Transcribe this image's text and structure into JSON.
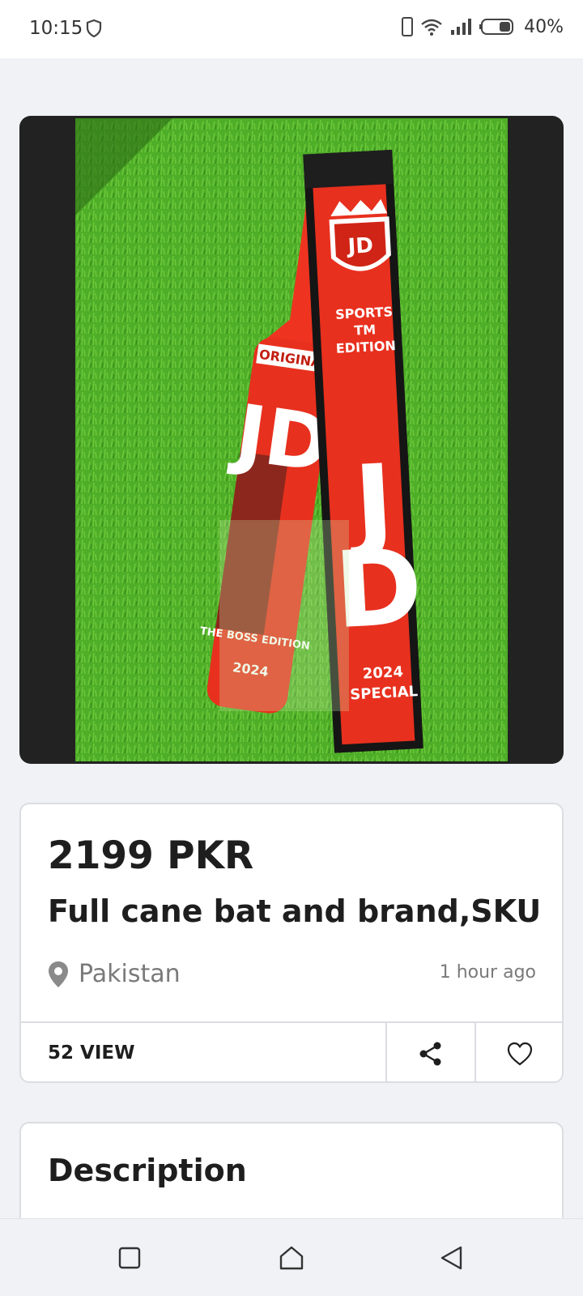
{
  "status_bar": {
    "time": "10:15",
    "battery": "40%"
  },
  "listing": {
    "image_alt": "Cricket bat and cover product photo",
    "image_texts": {
      "bat_top": "ORIGINAL",
      "bat_logo": "JD",
      "bat_edition": "THE BOSS EDITION",
      "bat_year": "2024",
      "cover_brand": "JD",
      "cover_line1": "SPORTS",
      "cover_line2": "TM",
      "cover_line3": "EDITION",
      "cover_year": "2024",
      "cover_special": "SPECIAL"
    },
    "price": "2199 PKR",
    "title": "Full cane bat and brand,SKU",
    "location": "Pakistan",
    "posted": "1 hour ago",
    "views": "52 VIEW"
  },
  "description": {
    "heading": "Description"
  },
  "colors": {
    "accent": "#e8301e",
    "grass": "#4fae28",
    "text": "#1e1e1e",
    "muted": "#7a7a7a"
  }
}
